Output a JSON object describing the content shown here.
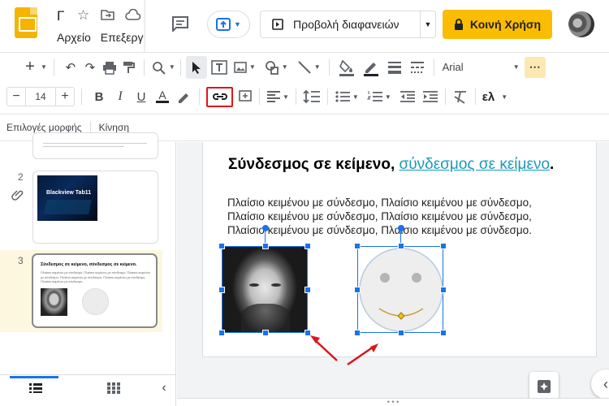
{
  "header": {
    "title": "Γ",
    "menus": [
      "Αρχείο",
      "Επεξεργ"
    ],
    "present_label": "Προβολή διαφανειών",
    "share_label": "Κοινή Χρήση"
  },
  "toolbar": {
    "font": "Arial",
    "font_size": "14",
    "lang_label": "ελ"
  },
  "options": {
    "format_options": "Επιλογές μορφής",
    "motion": "Κίνηση"
  },
  "filmstrip": {
    "slide2_number": "2",
    "slide2_text": "Blackview Tab11",
    "slide3_number": "3",
    "slide3_title": "Σύνδεσμος σε κείμενο, σύνδεσμος σε κείμενο.",
    "slide3_body": "Πλαίσιο κειμένου με σύνδεσμο, Πλαίσιο κειμένου με σύνδεσμο, Πλαίσιο κειμένου με σύνδεσμο, Πλαίσιο κειμένου με σύνδεσμο, Πλαίσιο κειμένου με σύνδεσμο, Πλαίσιο κειμένου με σύνδεσμο."
  },
  "slide": {
    "title_plain": "Σύνδεσμος σε κείμενο, ",
    "title_link": "σύνδεσμος σε κείμενο",
    "title_end": ".",
    "body_lines": [
      "Πλαίσιο κειμένου με σύνδεσμο, Πλαίσιο κειμένου με σύνδεσμο,",
      "Πλαίσιο κειμένου με σύνδεσμο, Πλαίσιο κειμένου με σύνδεσμο,",
      "Πλαίσιο κειμένου με σύνδεσμο, Πλαίσιο κειμένου με σύνδεσμο."
    ]
  },
  "colors": {
    "accent": "#1a73e8",
    "share": "#fbbc04",
    "link": "#1a9bb8",
    "highlight_box": "#e0141b",
    "arrow": "#e0141b"
  }
}
